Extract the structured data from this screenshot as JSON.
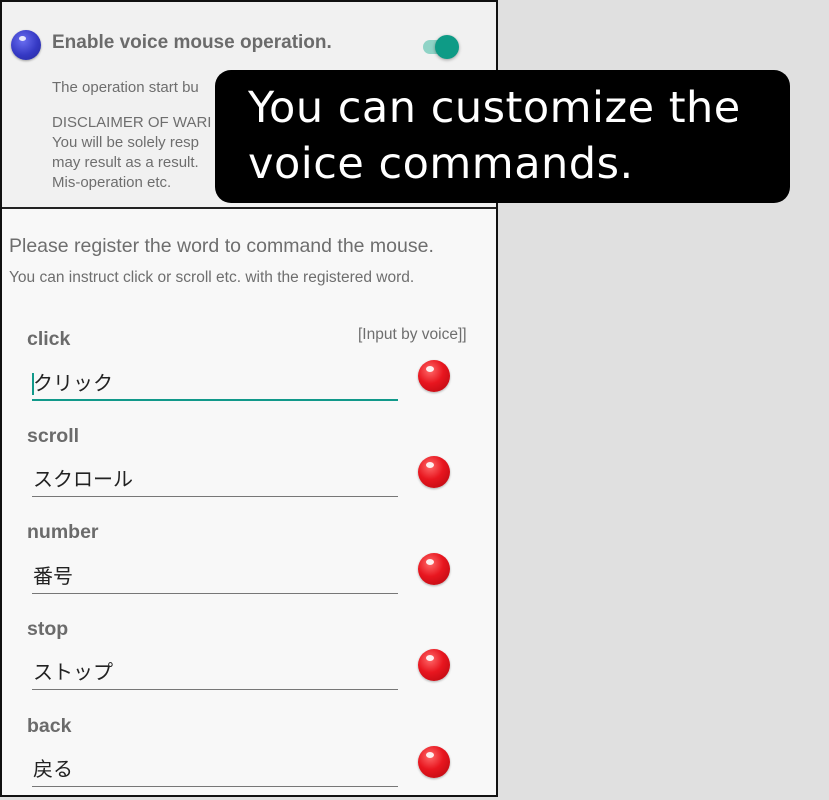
{
  "top": {
    "enable_title": "Enable voice mouse operation.",
    "toggle_state": "on",
    "desc_lines": [
      "The operation start bu",
      "DISCLAIMER OF WARI",
      "You will be solely resp",
      "may result as a result.",
      "Mis-operation etc."
    ]
  },
  "register": {
    "heading": "Please register the word to command the mouse.",
    "subheading": "You can instruct click or scroll etc. with the registered word.",
    "input_by_voice": "[Input by voice]]",
    "commands": [
      {
        "label": "click",
        "value": "クリック",
        "focused": true
      },
      {
        "label": "scroll",
        "value": "スクロール",
        "focused": false
      },
      {
        "label": "number",
        "value": "番号",
        "focused": false
      },
      {
        "label": "stop",
        "value": "ストップ",
        "focused": false
      },
      {
        "label": "back",
        "value": "戻る",
        "focused": false
      }
    ]
  },
  "callout": {
    "line1": "You can customize the",
    "line2": "voice commands."
  },
  "colors": {
    "accent": "#11998a",
    "record_button": "#e8161f",
    "voice_dot": "#3539c4",
    "background": "#e0e0e0"
  }
}
